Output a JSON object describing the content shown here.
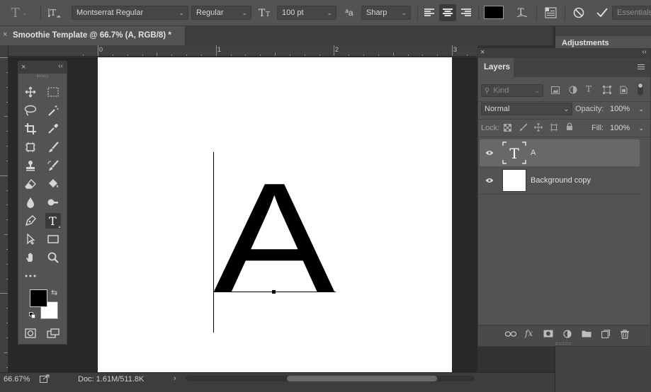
{
  "options_bar": {
    "font_family": "Montserrat Regular",
    "font_style": "Regular",
    "font_size": "100 pt",
    "anti_alias": "Sharp",
    "workspace": "Essentials",
    "text_color": "#000000"
  },
  "document": {
    "tab_title": "Smoothie Template @ 66.7% (A, RGB/8) *",
    "canvas_text": "A"
  },
  "rulers": {
    "top_labels": [
      "0",
      "1",
      "2",
      "3"
    ]
  },
  "layers_panel": {
    "tab_label": "Layers",
    "filter_placeholder": "Kind",
    "blend_mode": "Normal",
    "opacity_label": "Opacity:",
    "opacity_value": "100%",
    "lock_label": "Lock:",
    "fill_label": "Fill:",
    "fill_value": "100%",
    "layers": [
      {
        "name": "A",
        "type": "text",
        "selected": true
      },
      {
        "name": "Background copy",
        "type": "pixel",
        "selected": false
      }
    ]
  },
  "adjustments_panel": {
    "tab_label": "Adjustments"
  },
  "tools": {
    "foreground_color": "#000000",
    "background_color": "#ffffff"
  },
  "status_bar": {
    "zoom": "66.67%",
    "doc_info": "Doc: 1.61M/511.8K"
  }
}
